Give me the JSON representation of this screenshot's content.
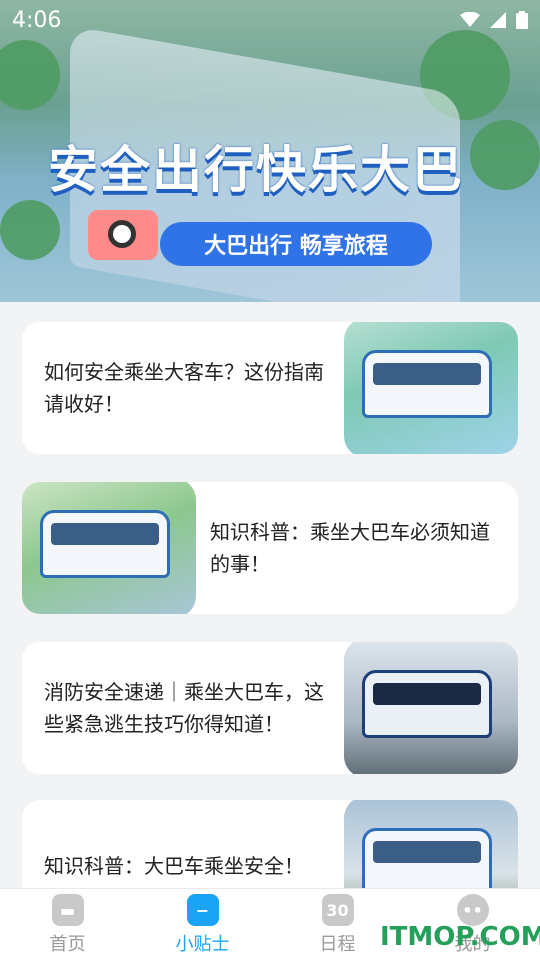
{
  "status_bar": {
    "time": "4:06"
  },
  "banner": {
    "title": "安全出行快乐大巴",
    "subtitle": "大巴出行 畅享旅程"
  },
  "articles": [
    {
      "title": "如何安全乘坐大客车？这份指南请收好！",
      "image_side": "right"
    },
    {
      "title": "知识科普：乘坐大巴车必须知道的事！",
      "image_side": "left"
    },
    {
      "title": "消防安全速递｜乘坐大巴车，这些紧急逃生技巧你得知道！",
      "image_side": "right"
    },
    {
      "title": "知识科普：大巴车乘坐安全！",
      "image_side": "right"
    }
  ],
  "tabbar": {
    "tabs": [
      {
        "label": "首页",
        "icon": "home-icon",
        "active": false
      },
      {
        "label": "小贴士",
        "icon": "tips-icon",
        "active": true
      },
      {
        "label": "日程",
        "icon": "calendar-icon",
        "active": false,
        "icon_text": "30"
      },
      {
        "label": "我的",
        "icon": "profile-icon",
        "active": false
      }
    ],
    "active_color": "#1ba4f5",
    "inactive_color": "#9a9a9a"
  },
  "watermark": "ITMOP.COM"
}
